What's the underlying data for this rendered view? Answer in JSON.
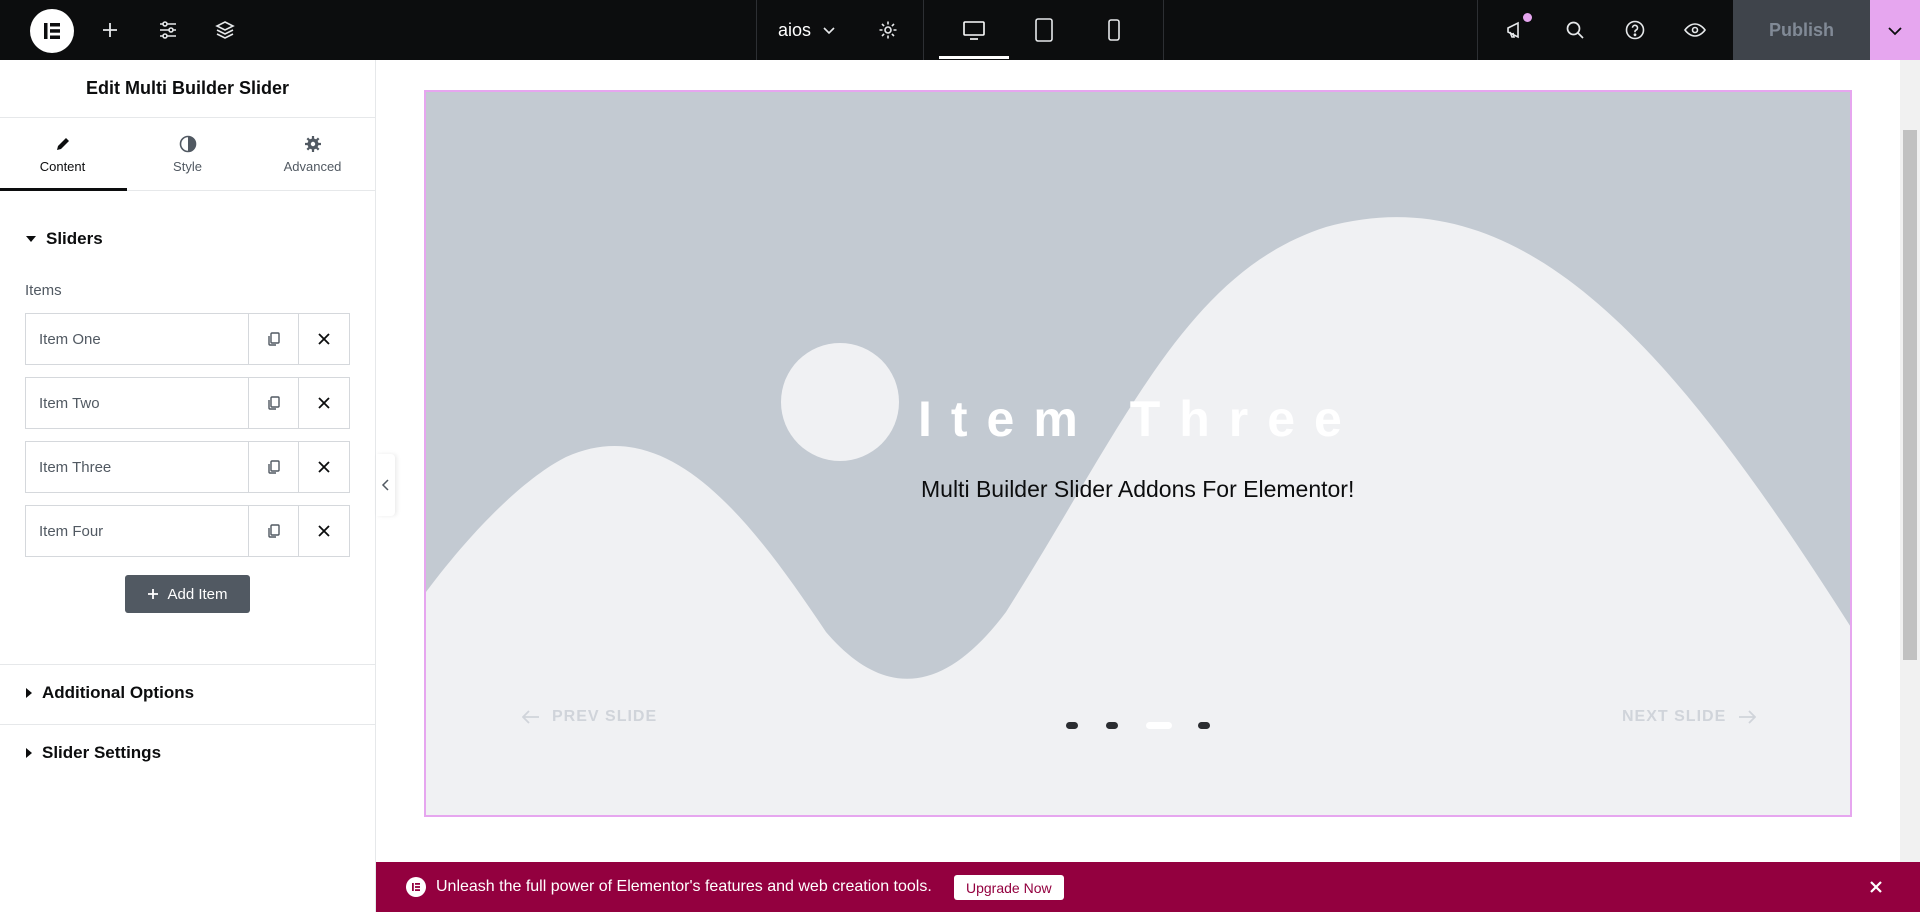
{
  "topbar": {
    "site_name": "aios",
    "publish_label": "Publish",
    "icons": [
      "elementor-logo-icon",
      "add-icon",
      "settings-sliders-icon",
      "layers-icon",
      "chevron-down-icon",
      "gear-icon",
      "desktop-icon",
      "tablet-icon",
      "mobile-icon",
      "megaphone-icon",
      "search-icon",
      "help-icon",
      "eye-icon",
      "chevron-down-icon"
    ]
  },
  "panel": {
    "title": "Edit Multi Builder Slider",
    "tabs": [
      {
        "label": "Content",
        "icon": "pencil-icon"
      },
      {
        "label": "Style",
        "icon": "contrast-icon"
      },
      {
        "label": "Advanced",
        "icon": "gear-icon"
      }
    ],
    "sliders_section": "Sliders",
    "items_label": "Items",
    "items": [
      {
        "title": "Item One"
      },
      {
        "title": "Item Two"
      },
      {
        "title": "Item Three"
      },
      {
        "title": "Item Four"
      }
    ],
    "add_item_label": "Add Item",
    "additional_options": "Additional Options",
    "slider_settings": "Slider Settings"
  },
  "slide": {
    "title": "Item Three",
    "subtitle": "Multi Builder Slider Addons For Elementor!",
    "prev_label": "PREV SLIDE",
    "next_label": "NEXT SLIDE",
    "dots_total": 4,
    "active_dot": 3
  },
  "promo": {
    "text": "Unleash the full power of Elementor's features and web creation tools.",
    "upgrade_label": "Upgrade Now"
  },
  "colors": {
    "accent_pink": "#e6a6ef",
    "promo_bg": "#93003f",
    "slide_bg": "#c3cad2",
    "slide_wave": "#f0f1f3"
  }
}
